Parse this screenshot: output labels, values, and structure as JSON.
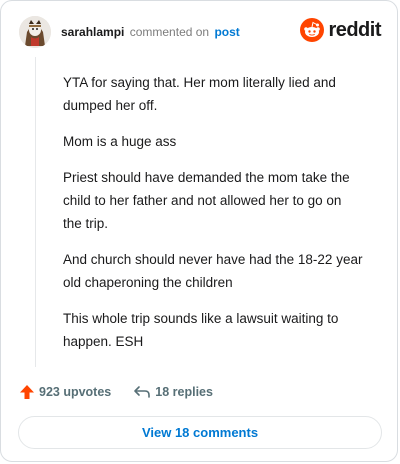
{
  "header": {
    "username": "sarahlampi",
    "commented_text": "commented on",
    "post_link": "post",
    "brand": "reddit"
  },
  "comment": {
    "paragraphs": [
      "YTA for saying that. Her mom literally lied and dumped her off.",
      "Mom is a huge ass",
      "Priest should have demanded the mom take the child to her father and not allowed her to go on the trip.",
      "And church should never have had the 18-22 year old chaperoning the children",
      "This whole trip sounds like a lawsuit waiting to happen. ESH"
    ]
  },
  "actions": {
    "upvotes": "923 upvotes",
    "replies": "18 replies"
  },
  "footer": {
    "view_comments": "View 18 comments"
  },
  "colors": {
    "reddit_orange": "#ff4500",
    "link_blue": "#0079d3",
    "muted": "#576f76"
  },
  "icons": {
    "upvote": "upvote-arrow-icon",
    "reply": "reply-arrow-icon",
    "logo": "reddit-snoo-icon"
  }
}
